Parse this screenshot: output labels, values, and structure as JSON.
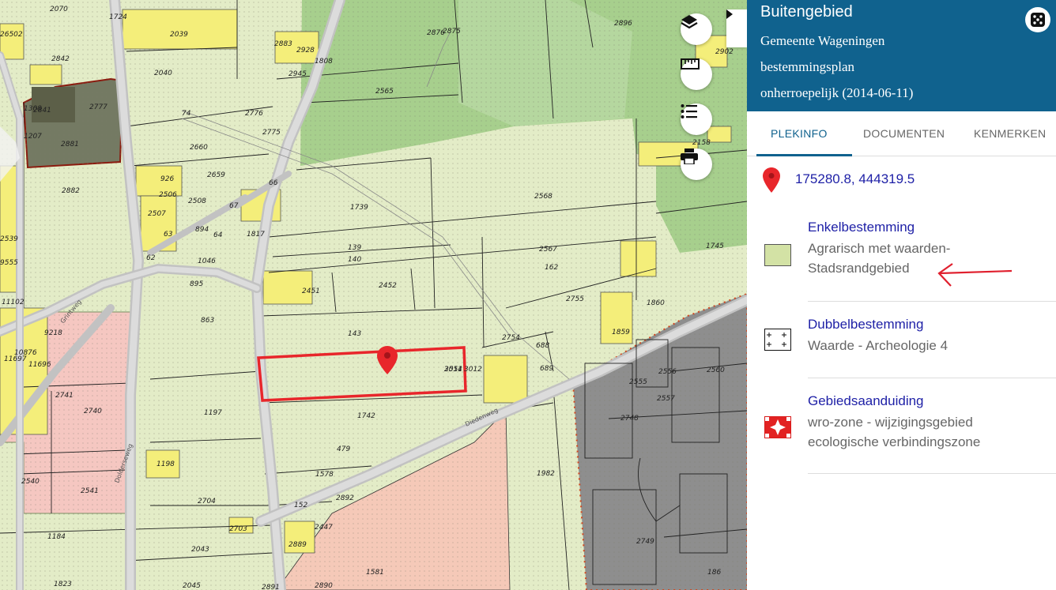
{
  "panel": {
    "title": "Buitengebied",
    "municipality": "Gemeente Wageningen",
    "plan_type": "bestemmingsplan",
    "status": "onherroepelijk (2014-06-11)"
  },
  "tabs": [
    "PLEKINFO",
    "DOCUMENTEN",
    "KENMERKEN"
  ],
  "coordinates": "175280.8, 444319.5",
  "legend": [
    {
      "title": "Enkelbestemming",
      "lines": [
        "Agrarisch met waarden-",
        "Stadsrandgebied"
      ]
    },
    {
      "title": "Dubbelbestemming",
      "lines": [
        "Waarde - Archeologie 4"
      ]
    },
    {
      "title": "Gebiedsaanduiding",
      "lines": [
        "wro-zone - wijzigingsgebied",
        "ecologische verbindingszone"
      ]
    }
  ],
  "map_buttons": [
    "layers-icon",
    "ruler-icon",
    "list-icon",
    "print-icon"
  ],
  "map": {
    "parcel_numbers": [
      "2070",
      "1724",
      "2039",
      "2883",
      "2928",
      "2876",
      "2896",
      "2902",
      "26502",
      "2842",
      "2040",
      "1808",
      "2945",
      "2875",
      "2565",
      "2841",
      "2777",
      "1308",
      "1207",
      "74",
      "2776",
      "2775",
      "2881",
      "2660",
      "2158",
      "2882",
      "926",
      "2659",
      "66",
      "2506",
      "2508",
      "67",
      "2507",
      "894",
      "64",
      "1817",
      "1739",
      "2568",
      "1745",
      "63",
      "1046",
      "139",
      "140",
      "2567",
      "162",
      "62",
      "895",
      "2451",
      "2452",
      "2755",
      "1860",
      "11102",
      "863",
      "143",
      "2754",
      "688",
      "1859",
      "9218",
      "2554",
      "2556",
      "2560",
      "10876",
      "11697",
      "11696",
      "3011",
      "3012",
      "689",
      "2555",
      "2741",
      "1742",
      "2557",
      "2740",
      "1197",
      "2748",
      "1198",
      "479",
      "2540",
      "1578",
      "1982",
      "2541",
      "2704",
      "2892",
      "152",
      "2703",
      "2447",
      "1184",
      "2043",
      "2889",
      "2749",
      "1581",
      "186",
      "1823",
      "2045",
      "2891",
      "2890",
      "2539",
      "9555"
    ],
    "street_names": [
      "Grintweg",
      "Dolderseweg",
      "Diedenweg"
    ]
  },
  "colors": {
    "header_bg": "#10628e",
    "active_tab": "#10628e",
    "link_text": "#1d1fa6",
    "marker_red": "#e8262b",
    "agrarisch_fill": "#d5e3a6",
    "wonen_yellow": "#f5f07a",
    "bos_green": "#a9d28e",
    "bedrijf_pink": "#f6c6c0",
    "gray_zone": "#8f8f8f"
  }
}
